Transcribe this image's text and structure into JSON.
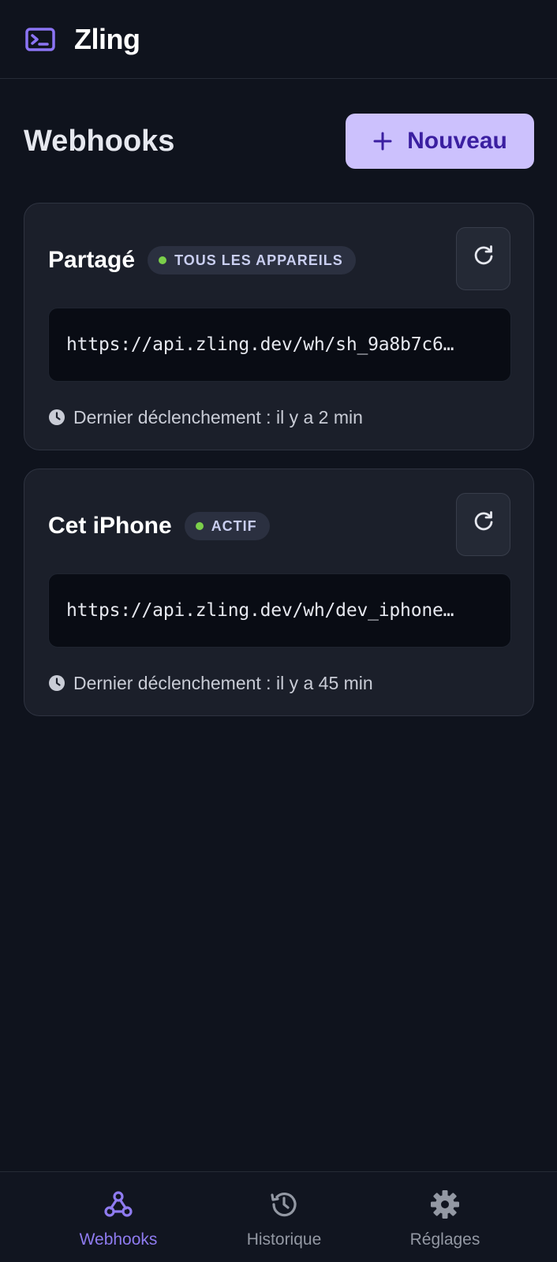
{
  "app": {
    "title": "Zling",
    "accent": "#8b74f4"
  },
  "page": {
    "title": "Webhooks",
    "new_button_label": "Nouveau"
  },
  "webhooks": [
    {
      "name": "Partagé",
      "badge": "TOUS LES APPAREILS",
      "badge_dot_color": "#7bcf4a",
      "url": "https://api.zling.dev/wh/sh_9a8b7c6…",
      "last_trigger": "Dernier déclenchement : il y a 2 min"
    },
    {
      "name": "Cet iPhone",
      "badge": "ACTIF",
      "badge_dot_color": "#7bcf4a",
      "url": "https://api.zling.dev/wh/dev_iphone…",
      "last_trigger": "Dernier déclenchement : il y a 45 min"
    }
  ],
  "nav": {
    "items": [
      {
        "label": "Webhooks",
        "icon": "webhook-icon",
        "active": true
      },
      {
        "label": "Historique",
        "icon": "history-icon",
        "active": false
      },
      {
        "label": "Réglages",
        "icon": "gear-icon",
        "active": false
      }
    ]
  }
}
